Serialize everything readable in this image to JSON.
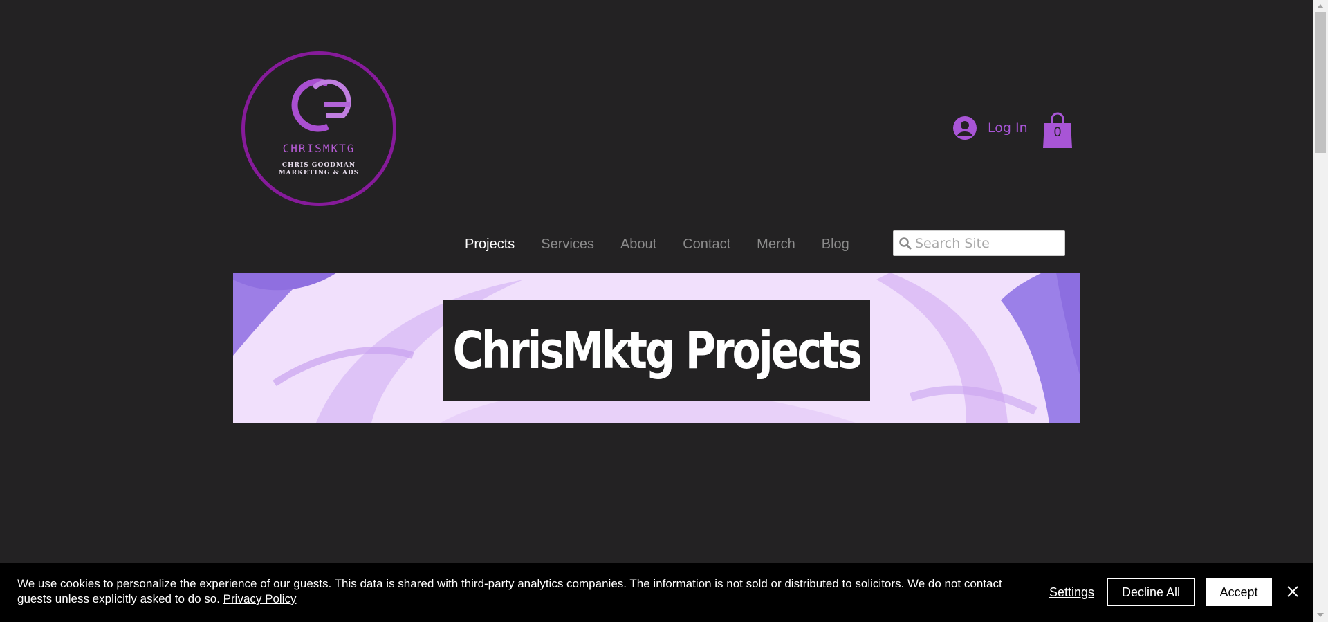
{
  "header": {
    "logo": {
      "name": "CHRISMKTG",
      "subtitle_line1": "CHRIS GOODMAN",
      "subtitle_line2": "MARKETING & ADS"
    },
    "login_label": "Log In",
    "cart_count": "0",
    "icons": {
      "login": "user-avatar-icon",
      "cart": "shopping-bag-icon",
      "search": "search-icon",
      "close": "close-icon"
    }
  },
  "nav": {
    "items": [
      {
        "label": "Projects",
        "active": true
      },
      {
        "label": "Services",
        "active": false
      },
      {
        "label": "About",
        "active": false
      },
      {
        "label": "Contact",
        "active": false
      },
      {
        "label": "Merch",
        "active": false
      },
      {
        "label": "Blog",
        "active": false
      }
    ]
  },
  "search": {
    "placeholder": "Search Site",
    "value": ""
  },
  "banner": {
    "title": "ChrisMktg Projects"
  },
  "cookie": {
    "message": "We use cookies to personalize the experience of our guests. This data is shared with third-party analytics companies. The information is not sold or distributed to solicitors. We do not contact guests unless explicitly asked to do so. ",
    "privacy_link": "Privacy Policy",
    "settings_label": "Settings",
    "decline_label": "Decline All",
    "accept_label": "Accept"
  },
  "colors": {
    "page_background": "#232223",
    "accent_purple": "#a855d6",
    "logo_ring": "#861b9a",
    "nav_active": "#ffffff",
    "nav_inactive": "#8b8b8b",
    "cookie_bar": "#000000"
  }
}
